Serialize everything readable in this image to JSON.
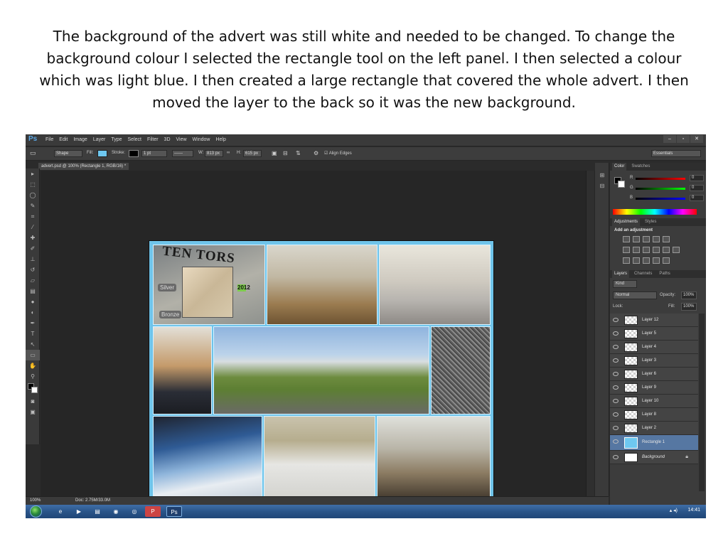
{
  "caption": "The background of the advert was still white and needed to be changed. To change the background colour I selected the rectangle tool on the left panel. I then selected a colour which was light blue. I then created a large rectangle that covered the whole advert. I then moved the layer to the back so it was the new background.",
  "app": {
    "logo": "Ps",
    "menu": [
      "File",
      "Edit",
      "Image",
      "Layer",
      "Type",
      "Select",
      "Filter",
      "3D",
      "View",
      "Window",
      "Help"
    ],
    "window_controls": [
      "–",
      "▫",
      "✕"
    ],
    "workspace": "Essentials"
  },
  "options_bar": {
    "mode": "Shape",
    "fill_label": "Fill:",
    "fill_color": "#6ec8f0",
    "stroke_label": "Stroke:",
    "stroke_color": "#000000",
    "stroke_width": "1 pt",
    "w_label": "W:",
    "w_value": "813 px",
    "h_label": "H:",
    "h_value": "615 px",
    "align_edges": "Align Edges"
  },
  "document_tab": "advert.psd @ 100% (Rectangle 1, RGB/16) *",
  "artwork": {
    "background_color": "#6fc4ea",
    "ten_tors": "TEN TORS",
    "silver": "Silver",
    "bronze": "Bronze",
    "year": "2012"
  },
  "status": {
    "zoom": "100%",
    "doc": "Doc: 2.75M/33.0M"
  },
  "color_panel": {
    "tabs": [
      "Color",
      "Swatches"
    ],
    "r_label": "R",
    "r_value": "0",
    "g_label": "G",
    "g_value": "0",
    "b_label": "B",
    "b_value": "0"
  },
  "adjustments_panel": {
    "tabs": [
      "Adjustments",
      "Styles"
    ],
    "add_label": "Add an adjustment"
  },
  "layers_panel": {
    "tabs": [
      "Layers",
      "Channels",
      "Paths"
    ],
    "kind": "Kind",
    "blend_mode": "Normal",
    "opacity_label": "Opacity:",
    "opacity_value": "100%",
    "lock_label": "Lock:",
    "fill_label": "Fill:",
    "fill_value": "100%",
    "layers": [
      {
        "name": "Layer 12"
      },
      {
        "name": "Layer 5"
      },
      {
        "name": "Layer 4"
      },
      {
        "name": "Layer 3"
      },
      {
        "name": "Layer 6"
      },
      {
        "name": "Layer 9"
      },
      {
        "name": "Layer 10"
      },
      {
        "name": "Layer 8"
      },
      {
        "name": "Layer 2"
      },
      {
        "name": "Rectangle 1"
      },
      {
        "name": "Background"
      }
    ]
  },
  "taskbar": {
    "time": "14:41"
  }
}
